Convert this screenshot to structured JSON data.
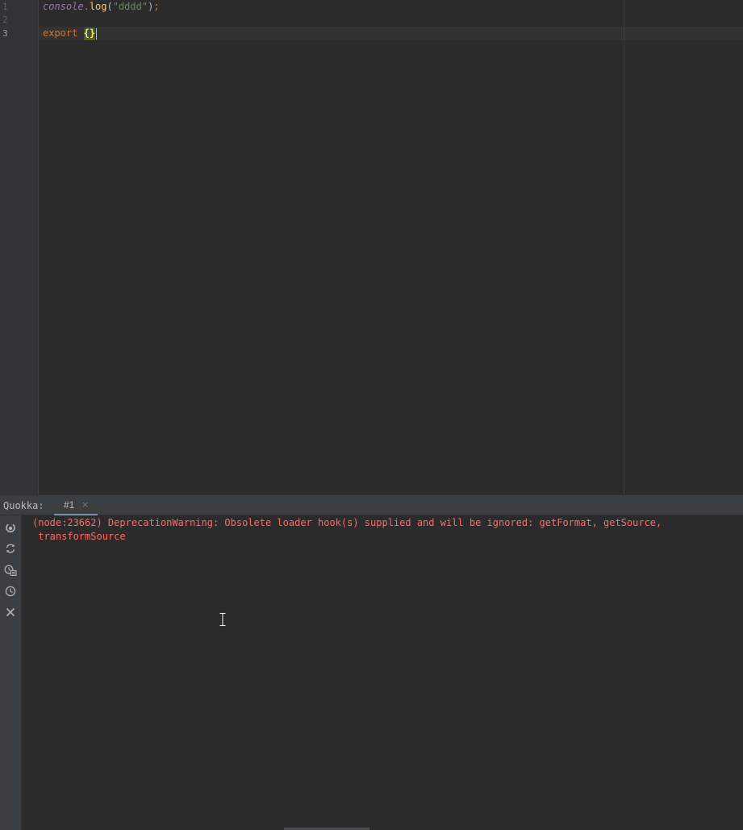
{
  "editor": {
    "line_numbers": [
      "1",
      "2",
      "3"
    ],
    "line1": {
      "console": "console",
      "dot": ".",
      "method": "log",
      "open_paren": "(",
      "string": "\"dddd\"",
      "close_paren": ")",
      "semicolon": ";"
    },
    "line3": {
      "keyword": "export",
      "braces": "{}"
    }
  },
  "tool_window": {
    "title": "Quokka:",
    "tab_label": "#1",
    "tab_close": "×",
    "toolbar_icons": [
      "start-icon",
      "refresh-icon",
      "coverage-icon",
      "history-icon",
      "close-icon"
    ]
  },
  "console": {
    "lines": [
      "(node:23662) DeprecationWarning: Obsolete loader hook(s) supplied and will be ignored: getFormat, getSource,",
      " transformSource"
    ]
  },
  "colors": {
    "editor_bg": "#2b2b2b",
    "gutter_bg": "#313335",
    "panel_bg": "#3c3f41",
    "error_text": "#ff6b68",
    "keyword": "#cc7832",
    "string": "#6a8759",
    "method": "#ffc66d",
    "global_object": "#9876aa"
  }
}
